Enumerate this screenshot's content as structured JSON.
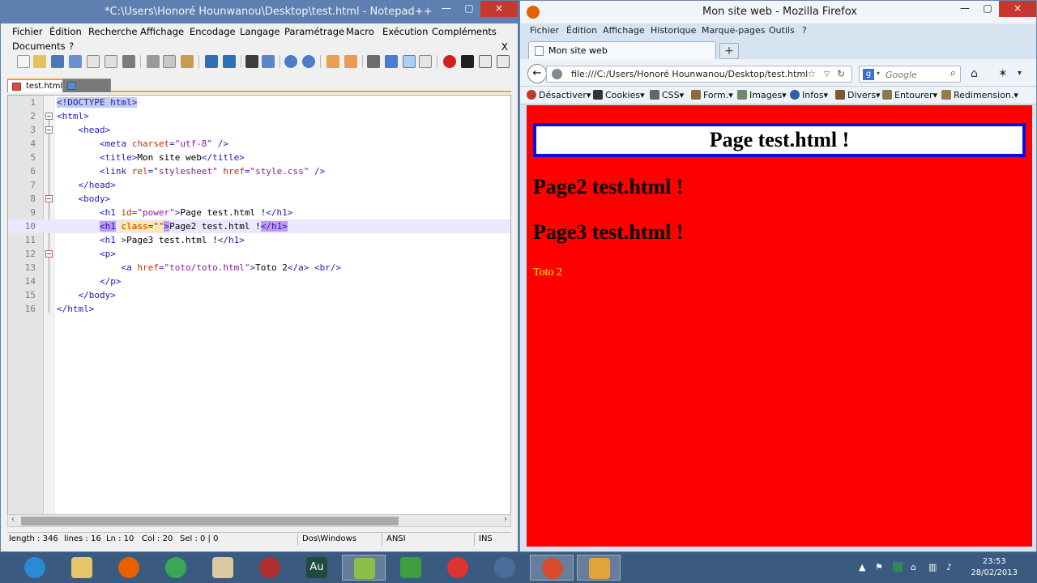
{
  "npp": {
    "title": "*C:\\Users\\Honoré Hounwanou\\Desktop\\test.html - Notepad++",
    "close_char": "×",
    "menu": [
      "Fichier",
      "Édition",
      "Recherche",
      "Affichage",
      "Encodage",
      "Langage",
      "Paramétrage",
      "Macro",
      "Exécution",
      "Compléments",
      "Documents",
      "?"
    ],
    "close_doc": "X",
    "tabs": [
      {
        "label": "test.html"
      }
    ],
    "editor": {
      "line_numbers": [
        "1",
        "2",
        "3",
        "4",
        "5",
        "6",
        "7",
        "8",
        "9",
        "10",
        "11",
        "12",
        "13",
        "14",
        "15",
        "16"
      ],
      "current_line": 10
    },
    "status": {
      "length": "length : 346",
      "lines": "lines : 16",
      "ln": "Ln : 10",
      "col": "Col : 20",
      "sel": "Sel : 0 | 0",
      "eol": "Dos\\Windows",
      "encoding": "ANSI",
      "mode": "INS"
    }
  },
  "firefox": {
    "title": "Mon site web - Mozilla Firefox",
    "menu": [
      "Fichier",
      "Édition",
      "Affichage",
      "Historique",
      "Marque-pages",
      "Outils",
      "?"
    ],
    "tab_label": "Mon site web",
    "new_tab": "+",
    "url": "file:///C:/Users/Honoré Hounwanou/Desktop/test.html",
    "search_placeholder": "Google",
    "bookmarks": [
      "Désactiver▾",
      "Cookies▾",
      "CSS▾",
      "Form.▾",
      "Images▾",
      "Infos▾",
      "Divers▾",
      "Entourer▾",
      "Redimension.▾"
    ],
    "page": {
      "h1_power": "Page test.html !",
      "h1_2": "Page2 test.html !",
      "h1_3": "Page3 test.html !",
      "link": "Toto 2"
    },
    "bg_color": "#ff0000",
    "border_color": "#0b0ee0",
    "link_color": "#ffff00"
  },
  "taskbar": {
    "time": "23:53",
    "date": "28/02/2013",
    "apps": [
      "ie-icon",
      "explorer-icon",
      "firefox-icon",
      "chrome-icon",
      "files-icon",
      "spider-icon",
      "audition-icon",
      "notepadpp-icon",
      "tiles-icon",
      "picasa-icon",
      "steam-icon",
      "chrome-alt-icon",
      "notepad-alt-icon"
    ],
    "audition_label": "Au"
  }
}
